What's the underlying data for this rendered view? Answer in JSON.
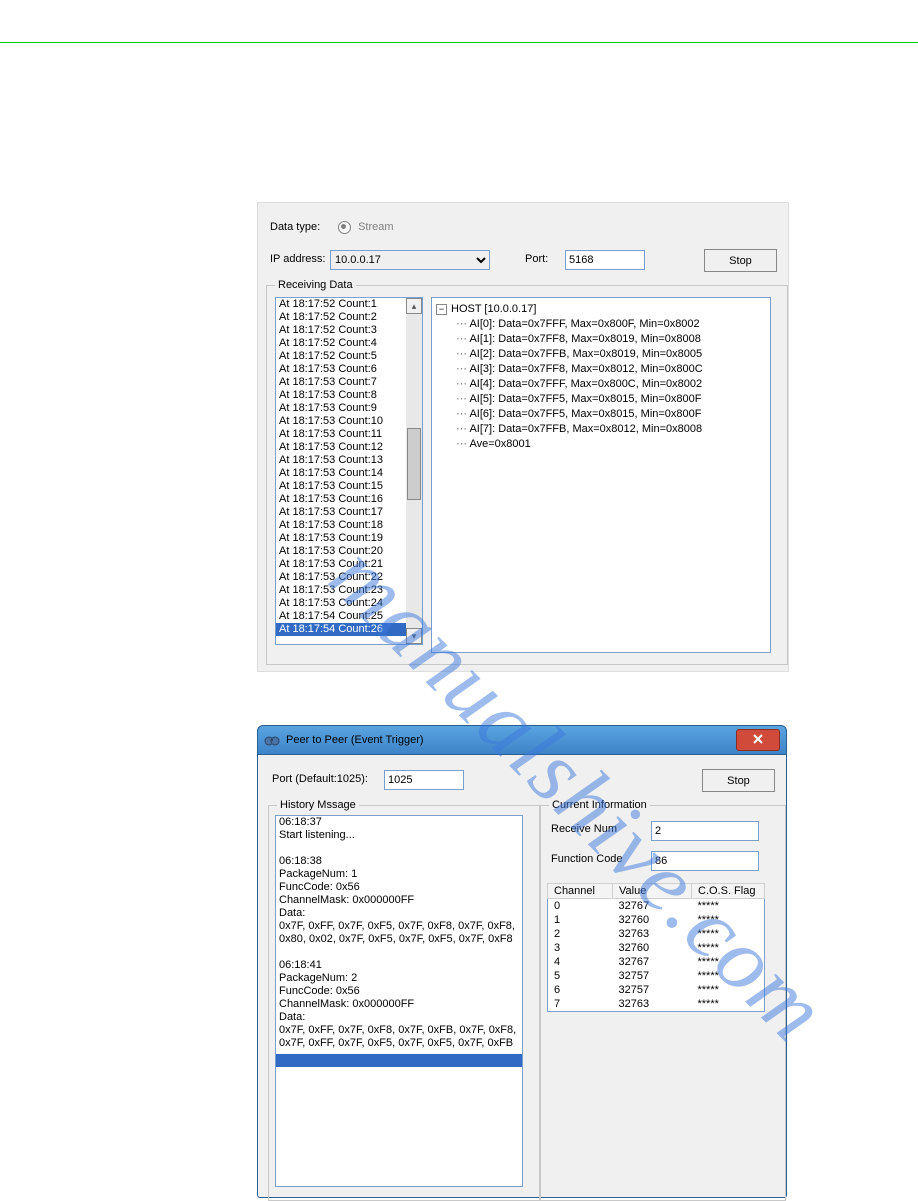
{
  "top": {
    "dataTypeLabel": "Data type:",
    "streamLabel": "Stream",
    "ipLabel": "IP address:",
    "ipValue": "10.0.0.17",
    "portLabel": "Port:",
    "portValue": "5168",
    "stopLabel": "Stop",
    "receivingLegend": "Receiving Data",
    "listItems": [
      "At 18:17:52 Count:1",
      "At 18:17:52 Count:2",
      "At 18:17:52 Count:3",
      "At 18:17:52 Count:4",
      "At 18:17:52 Count:5",
      "At 18:17:53 Count:6",
      "At 18:17:53 Count:7",
      "At 18:17:53 Count:8",
      "At 18:17:53 Count:9",
      "At 18:17:53 Count:10",
      "At 18:17:53 Count:11",
      "At 18:17:53 Count:12",
      "At 18:17:53 Count:13",
      "At 18:17:53 Count:14",
      "At 18:17:53 Count:15",
      "At 18:17:53 Count:16",
      "At 18:17:53 Count:17",
      "At 18:17:53 Count:18",
      "At 18:17:53 Count:19",
      "At 18:17:53 Count:20",
      "At 18:17:53 Count:21",
      "At 18:17:53 Count:22",
      "At 18:17:53 Count:23",
      "At 18:17:53 Count:24",
      "At 18:17:54 Count:25",
      "At 18:17:54 Count:26"
    ],
    "treeRoot": "HOST [10.0.0.17]",
    "treeItems": [
      "AI[0]: Data=0x7FFF, Max=0x800F, Min=0x8002",
      "AI[1]: Data=0x7FF8, Max=0x8019, Min=0x8008",
      "AI[2]: Data=0x7FFB, Max=0x8019, Min=0x8005",
      "AI[3]: Data=0x7FF8, Max=0x8012, Min=0x800C",
      "AI[4]: Data=0x7FFF, Max=0x800C, Min=0x8002",
      "AI[5]: Data=0x7FF5, Max=0x8015, Min=0x800F",
      "AI[6]: Data=0x7FF5, Max=0x8015, Min=0x800F",
      "AI[7]: Data=0x7FFB, Max=0x8012, Min=0x8008",
      "Ave=0x8001"
    ]
  },
  "p2p": {
    "title": "Peer to Peer (Event Trigger)",
    "portLabel": "Port (Default:1025):",
    "portValue": "1025",
    "stopLabel": "Stop",
    "historyLegend": "History Mssage",
    "currentLegend": "Current Information",
    "recvNumLabel": "Receive Num",
    "recvNumValue": "2",
    "funcCodeLabel": "Function Code",
    "funcCodeValue": "86",
    "historyLines": [
      "06:18:37",
      "Start listening...",
      "",
      "06:18:38",
      "PackageNum: 1",
      "FuncCode: 0x56",
      "ChannelMask: 0x000000FF",
      "Data:",
      "0x7F, 0xFF, 0x7F, 0xF5, 0x7F, 0xF8, 0x7F, 0xF8,",
      "0x80, 0x02, 0x7F, 0xF5, 0x7F, 0xF5, 0x7F, 0xF8",
      "",
      "06:18:41",
      "PackageNum: 2",
      "FuncCode: 0x56",
      "ChannelMask: 0x000000FF",
      "Data:",
      "0x7F, 0xFF, 0x7F, 0xF8, 0x7F, 0xFB, 0x7F, 0xF8,",
      "0x7F, 0xFF, 0x7F, 0xF5, 0x7F, 0xF5, 0x7F, 0xFB"
    ],
    "columns": [
      "Channel",
      "Value",
      "C.O.S. Flag"
    ],
    "rows": [
      {
        "ch": "0",
        "val": "32767",
        "flag": "*****"
      },
      {
        "ch": "1",
        "val": "32760",
        "flag": "*****"
      },
      {
        "ch": "2",
        "val": "32763",
        "flag": "*****"
      },
      {
        "ch": "3",
        "val": "32760",
        "flag": "*****"
      },
      {
        "ch": "4",
        "val": "32767",
        "flag": "*****"
      },
      {
        "ch": "5",
        "val": "32757",
        "flag": "*****"
      },
      {
        "ch": "6",
        "val": "32757",
        "flag": "*****"
      },
      {
        "ch": "7",
        "val": "32763",
        "flag": "*****"
      }
    ]
  },
  "watermark": "manualshive.com"
}
